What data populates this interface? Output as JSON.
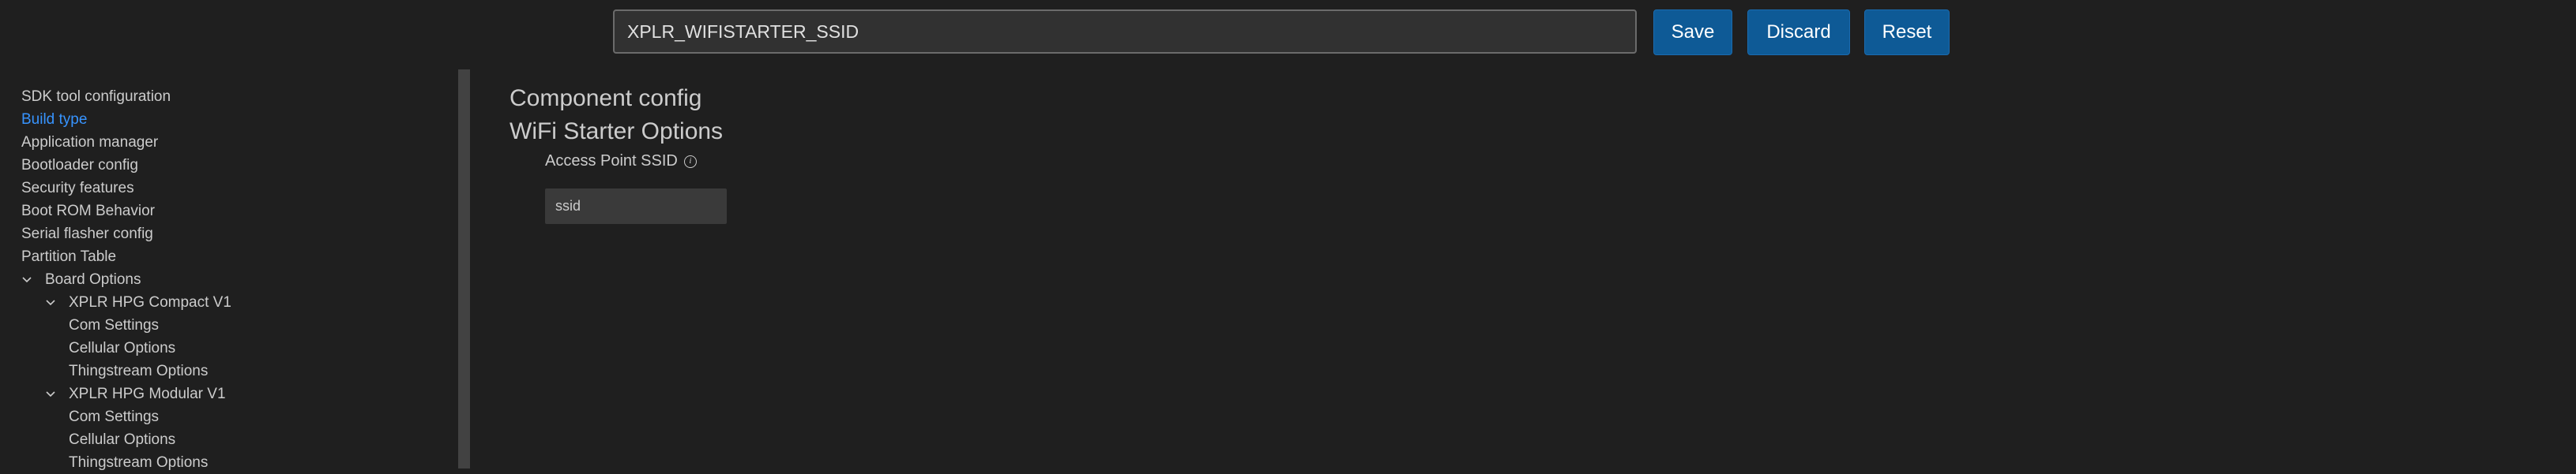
{
  "search": {
    "value": "XPLR_WIFISTARTER_SSID"
  },
  "toolbar": {
    "save_label": "Save",
    "discard_label": "Discard",
    "reset_label": "Reset"
  },
  "sidebar": {
    "items": [
      {
        "label": "SDK tool configuration"
      },
      {
        "label": "Build type",
        "active": true
      },
      {
        "label": "Application manager"
      },
      {
        "label": "Bootloader config"
      },
      {
        "label": "Security features"
      },
      {
        "label": "Boot ROM Behavior"
      },
      {
        "label": "Serial flasher config"
      },
      {
        "label": "Partition Table"
      },
      {
        "label": "Board Options",
        "expanded": true
      },
      {
        "label": "XPLR HPG Compact V1",
        "expanded": true
      },
      {
        "label": "Com Settings"
      },
      {
        "label": "Cellular Options"
      },
      {
        "label": "Thingstream Options"
      },
      {
        "label": "XPLR HPG Modular V1",
        "expanded": true
      },
      {
        "label": "Com Settings"
      },
      {
        "label": "Cellular Options"
      },
      {
        "label": "Thingstream Options"
      }
    ]
  },
  "main": {
    "section_title": "Component config",
    "subsection_title": "WiFi Starter Options",
    "field": {
      "label": "Access Point SSID",
      "value": "ssid"
    }
  },
  "colors": {
    "accent": "#0e5a96",
    "active_link": "#3794ff",
    "background": "#1f1f1f"
  },
  "icons": {
    "info": "info-icon",
    "chevron": "chevron-down-icon"
  }
}
